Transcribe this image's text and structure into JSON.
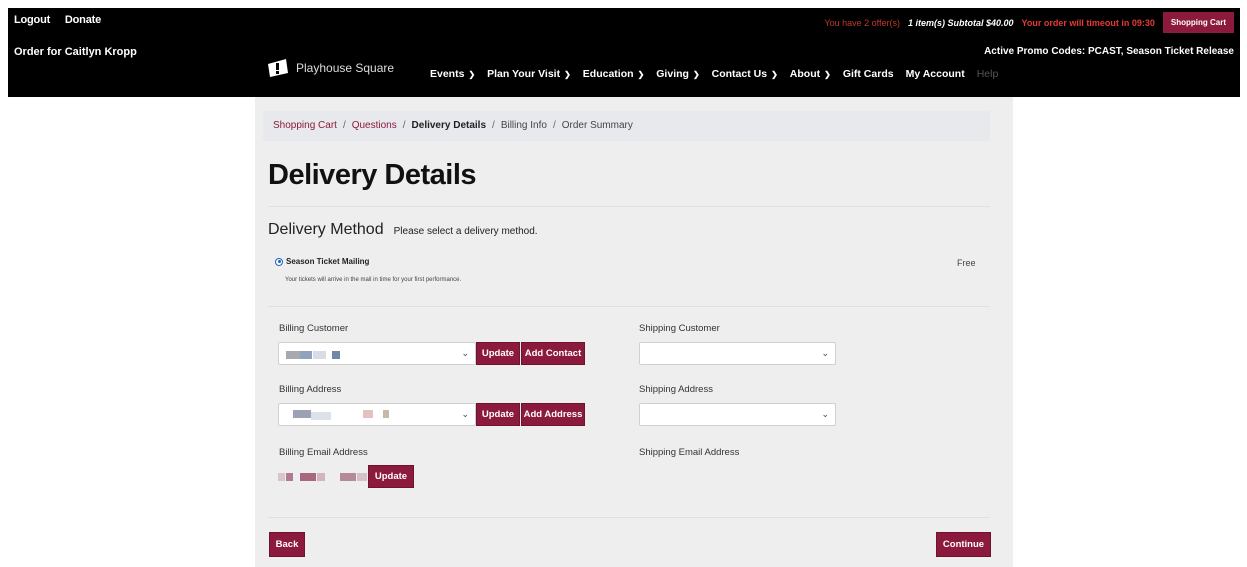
{
  "utility": {
    "logout": "Logout",
    "donate": "Donate",
    "order_for": "Order for Caitlyn Kropp"
  },
  "status": {
    "offers": "You have 2 offer(s)",
    "subtotal": "1 item(s) Subtotal $40.00",
    "timeout": "Your order will timeout in 09:30",
    "cart_button": "Shopping Cart",
    "promo": "Active Promo Codes: PCAST, Season Ticket Release"
  },
  "brand": {
    "name": "Playhouse Square"
  },
  "nav": {
    "events": "Events",
    "plan": "Plan Your Visit",
    "education": "Education",
    "giving": "Giving",
    "contact": "Contact Us",
    "about": "About",
    "gift_cards": "Gift Cards",
    "account": "My Account",
    "help": "Help"
  },
  "breadcrumb": {
    "cart": "Shopping Cart",
    "questions": "Questions",
    "delivery": "Delivery Details",
    "billing": "Billing Info",
    "summary": "Order Summary",
    "sep": "/"
  },
  "page": {
    "title": "Delivery Details"
  },
  "delivery": {
    "heading": "Delivery Method",
    "subheading": "Please select a delivery method.",
    "option_label": "Season Ticket Mailing",
    "option_desc": "Your tickets will arrive in the mail in time for your first performance.",
    "option_price": "Free"
  },
  "billing": {
    "customer_label": "Billing Customer",
    "address_label": "Billing Address",
    "email_label": "Billing Email Address",
    "update": "Update",
    "add_contact": "Add Contact",
    "add_address": "Add Address"
  },
  "shipping": {
    "customer_label": "Shipping Customer",
    "address_label": "Shipping Address",
    "email_label": "Shipping Email Address"
  },
  "actions": {
    "back": "Back",
    "continue": "Continue"
  },
  "colors": {
    "brand": "#8b1a3c",
    "topbar": "#000000",
    "panel": "#eeeeee",
    "alert": "#e53935"
  },
  "icons": {
    "dropdown": "chevron-down-icon",
    "radio": "radio-selected-icon",
    "logo": "playhouse-logo-icon"
  }
}
